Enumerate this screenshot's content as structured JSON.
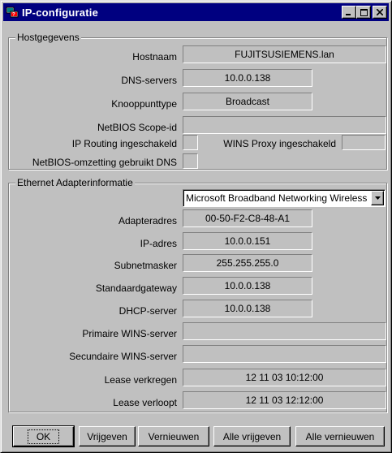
{
  "window": {
    "title": "IP-configuratie",
    "controls": {
      "minimize": "_",
      "maximize": "□",
      "close": "✕"
    }
  },
  "host": {
    "group_label": "Hostgegevens",
    "hostnaam_label": "Hostnaam",
    "hostnaam_value": "FUJITSUSIEMENS.lan",
    "dns_label": "DNS-servers",
    "dns_value": "10.0.0.138",
    "knooppunttype_label": "Knooppunttype",
    "knooppunttype_value": "Broadcast",
    "netbios_scope_label": "NetBIOS Scope-id",
    "netbios_scope_value": "",
    "ip_routing_label": "IP Routing ingeschakeld",
    "wins_proxy_label": "WINS Proxy ingeschakeld",
    "netbios_dns_label": "NetBIOS-omzetting gebruikt DNS"
  },
  "ethernet": {
    "group_label": "Ethernet  Adapterinformatie",
    "adapter_selected": "Microsoft Broadband Networking Wireless",
    "adapteradres_label": "Adapteradres",
    "adapteradres_value": "00-50-F2-C8-48-A1",
    "ip_label": "IP-adres",
    "ip_value": "10.0.0.151",
    "subnet_label": "Subnetmasker",
    "subnet_value": "255.255.255.0",
    "gateway_label": "Standaardgateway",
    "gateway_value": "10.0.0.138",
    "dhcp_label": "DHCP-server",
    "dhcp_value": "10.0.0.138",
    "wins_primary_label": "Primaire WINS-server",
    "wins_primary_value": "",
    "wins_secondary_label": "Secundaire WINS-server",
    "wins_secondary_value": "",
    "lease_obtained_label": "Lease verkregen",
    "lease_obtained_value": "12 11 03 10:12:00",
    "lease_expires_label": "Lease verloopt",
    "lease_expires_value": "12 11 03 12:12:00"
  },
  "buttons": {
    "ok": "OK",
    "release": "Vrijgeven",
    "renew": "Vernieuwen",
    "release_all": "Alle vrijgeven",
    "renew_all": "Alle vernieuwen"
  },
  "colors": {
    "titlebar": "#000080",
    "face": "#c0c0c0"
  }
}
